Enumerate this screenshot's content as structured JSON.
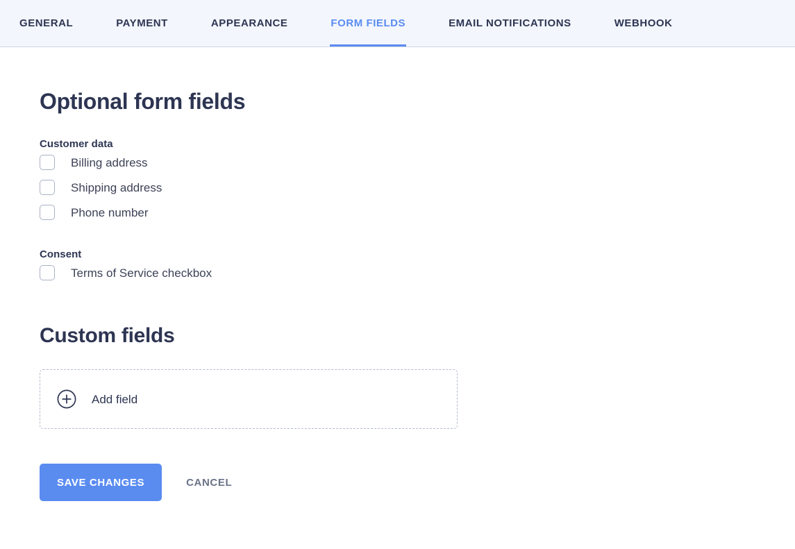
{
  "tabs": [
    {
      "id": "general",
      "label": "GENERAL",
      "active": false
    },
    {
      "id": "payment",
      "label": "PAYMENT",
      "active": false
    },
    {
      "id": "appearance",
      "label": "APPEARANCE",
      "active": false
    },
    {
      "id": "form-fields",
      "label": "FORM FIELDS",
      "active": true
    },
    {
      "id": "email-notifications",
      "label": "EMAIL NOTIFICATIONS",
      "active": false
    },
    {
      "id": "webhook",
      "label": "WEBHOOK",
      "active": false
    }
  ],
  "optional_form_fields": {
    "title": "Optional form fields",
    "groups": [
      {
        "id": "customer-data",
        "label": "Customer data",
        "options": [
          {
            "id": "billing-address",
            "label": "Billing address",
            "checked": false
          },
          {
            "id": "shipping-address",
            "label": "Shipping address",
            "checked": false
          },
          {
            "id": "phone-number",
            "label": "Phone number",
            "checked": false
          }
        ]
      },
      {
        "id": "consent",
        "label": "Consent",
        "options": [
          {
            "id": "terms-of-service",
            "label": "Terms of Service checkbox",
            "checked": false
          }
        ]
      }
    ]
  },
  "custom_fields": {
    "title": "Custom fields",
    "add_field": {
      "label": "Add field",
      "icon": "plus-circle-icon"
    }
  },
  "actions": {
    "save_label": "SAVE CHANGES",
    "cancel_label": "CANCEL"
  },
  "colors": {
    "accent": "#5a8cf0",
    "header_bg": "#f3f6fd",
    "heading_text": "#2d3552",
    "body_text": "#3c4257",
    "muted_text": "#6b7388",
    "checkbox_border": "#aab1c6",
    "dashed_border": "#b4bbcd"
  }
}
